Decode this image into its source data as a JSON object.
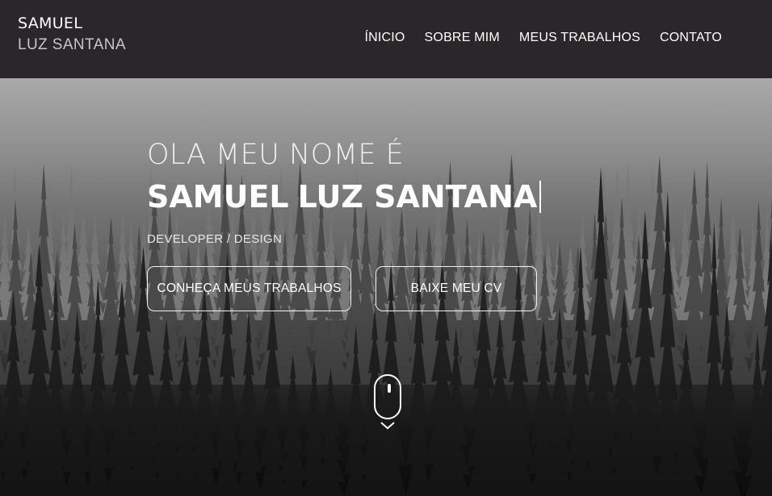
{
  "brand": {
    "first_name": "SAMUEL",
    "last_name": "LUZ SANTANA"
  },
  "nav": {
    "items": [
      {
        "label": "ÍNICIO"
      },
      {
        "label": "SOBRE MIM"
      },
      {
        "label": "MEUS TRABALHOS"
      },
      {
        "label": "CONTATO"
      }
    ]
  },
  "hero": {
    "greeting": "OLA MEU NOME É",
    "name_bold": "SAMUEL",
    "name_rest": "LUZ SANTANA",
    "role": "DEVELOPER / DESIGN",
    "buttons": {
      "work_label": "CONHEÇA MEUS TRABALHOS",
      "cv_label": "BAIXE MEU CV"
    }
  },
  "colors": {
    "navbar_bg": "#2b2629",
    "text": "#ffffff",
    "brand_secondary": "#c9c5c7"
  },
  "icons": {
    "scroll": "mouse-scroll-icon",
    "scroll_arrow": "chevron-down-icon"
  }
}
